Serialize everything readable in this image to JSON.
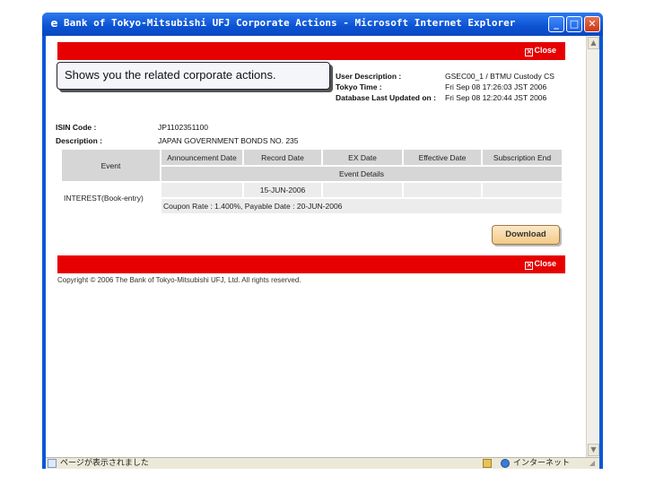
{
  "window": {
    "title": "Bank of Tokyo-Mitsubishi UFJ  Corporate Actions - Microsoft Internet Explorer",
    "minimize_glyph": "_",
    "maximize_glyph": "□",
    "close_glyph": "✕"
  },
  "tooltip": {
    "text": "Shows you the related corporate actions."
  },
  "header_bar": {
    "close_label": "Close"
  },
  "user_info": {
    "user_description_label": "User Description :",
    "user_description_value": "GSEC00_1 / BTMU Custody CS",
    "tokyo_time_label": "Tokyo Time :",
    "tokyo_time_value": "Fri Sep 08 17:26:03 JST 2006",
    "db_updated_label": "Database Last Updated on :",
    "db_updated_value": "Fri Sep 08 12:20:44 JST 2006"
  },
  "security": {
    "isin_label": "ISIN Code :",
    "isin_value": "JP1102351100",
    "description_label": "Description :",
    "description_value": "JAPAN GOVERNMENT BONDS NO. 235"
  },
  "table": {
    "event_header": "Event",
    "columns": [
      "Announcement Date",
      "Record Date",
      "EX Date",
      "Effective Date",
      "Subscription End"
    ],
    "event_details_header": "Event Details",
    "row": {
      "event": "INTEREST(Book-entry)",
      "announcement_date": "",
      "record_date": "15-JUN-2006",
      "ex_date": "",
      "effective_date": "",
      "subscription_end": "",
      "details": "Coupon Rate : 1.400%, Payable Date : 20-JUN-2006"
    }
  },
  "download_button": {
    "label": "Download"
  },
  "footer_bar": {
    "close_label": "Close"
  },
  "copyright": "Copyright © 2006 The Bank of Tokyo-Mitsubishi UFJ, Ltd. All rights reserved.",
  "statusbar": {
    "text": "ページが表示されました",
    "zone": "インターネット"
  },
  "colors": {
    "accent_red": "#e60000",
    "titlebar_blue": "#0b52d2",
    "table_header_gray": "#d6d6d6",
    "button_orange": "#f3c987"
  }
}
